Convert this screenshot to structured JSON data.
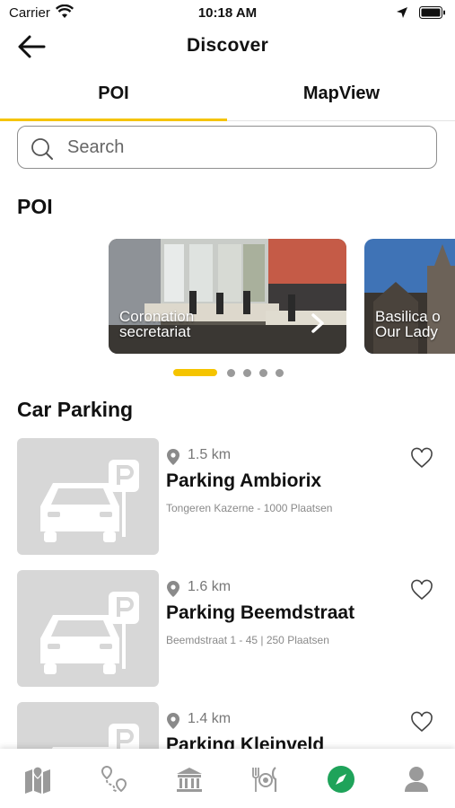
{
  "status_bar": {
    "carrier": "Carrier",
    "time": "10:18 AM"
  },
  "header": {
    "title": "Discover"
  },
  "tabs": [
    {
      "label": "POI"
    },
    {
      "label": "MapView"
    }
  ],
  "search": {
    "placeholder": "Search"
  },
  "poi_section": {
    "title": "POI",
    "cards": [
      {
        "label": "Coronation\nsecretariat"
      },
      {
        "label": "Basilica o\nOur Lady"
      }
    ],
    "pager": {
      "pages": 5,
      "active": 1
    }
  },
  "parking_section": {
    "title": "Car Parking",
    "items": [
      {
        "distance": "1.5 km",
        "name": "Parking Ambiorix",
        "detail": "Tongeren Kazerne - 1000 Plaatsen"
      },
      {
        "distance": "1.6 km",
        "name": "Parking Beemdstraat",
        "detail": "Beemdstraat 1 - 45 | 250 Plaatsen"
      },
      {
        "distance": "1.4 km",
        "name": "Parking Kleinveld",
        "detail": ""
      }
    ]
  },
  "bottom_nav": {
    "items": [
      "map-icon",
      "route-icon",
      "museum-icon",
      "restaurant-icon",
      "compass-icon",
      "profile-icon"
    ],
    "active": "compass-icon",
    "active_color": "#1fa35a"
  },
  "colors": {
    "accent": "#f5c400"
  }
}
